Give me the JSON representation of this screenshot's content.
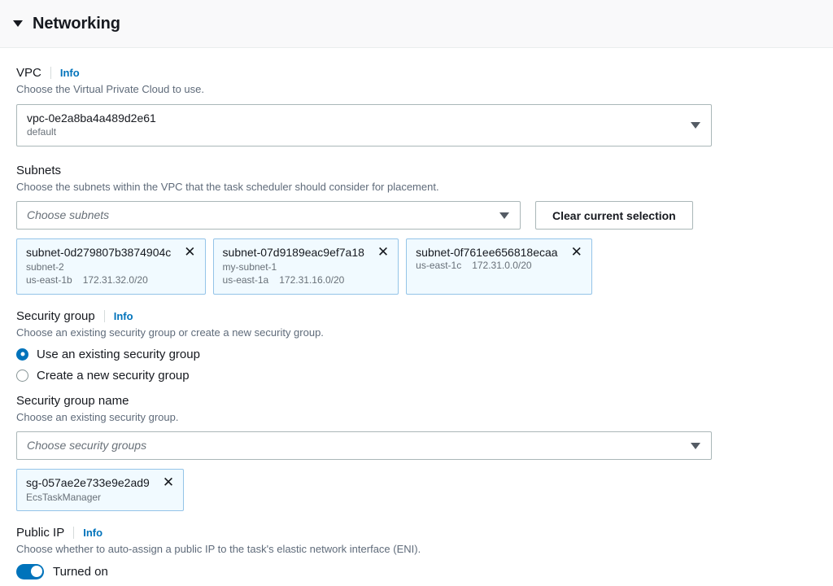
{
  "section": {
    "title": "Networking",
    "collapse_icon": "caret-down-icon"
  },
  "vpc": {
    "label": "VPC",
    "info_label": "Info",
    "description": "Choose the Virtual Private Cloud to use.",
    "selected_value": "vpc-0e2a8ba4a489d2e61",
    "selected_sub": "default"
  },
  "subnets": {
    "label": "Subnets",
    "description": "Choose the subnets within the VPC that the task scheduler should consider for placement.",
    "placeholder": "Choose subnets",
    "clear_button": "Clear current selection",
    "tokens": [
      {
        "id": "subnet-0d279807b3874904c",
        "name": "subnet-2",
        "az": "us-east-1b",
        "cidr": "172.31.32.0/20",
        "remove_icon": "close-icon"
      },
      {
        "id": "subnet-07d9189eac9ef7a18",
        "name": "my-subnet-1",
        "az": "us-east-1a",
        "cidr": "172.31.16.0/20",
        "remove_icon": "close-icon"
      },
      {
        "id": "subnet-0f761ee656818ecaa",
        "name": "",
        "az": "us-east-1c",
        "cidr": "172.31.0.0/20",
        "remove_icon": "close-icon"
      }
    ]
  },
  "security_group": {
    "label": "Security group",
    "info_label": "Info",
    "description": "Choose an existing security group or create a new security group.",
    "options": [
      {
        "label": "Use an existing security group",
        "selected": true
      },
      {
        "label": "Create a new security group",
        "selected": false
      }
    ],
    "name_label": "Security group name",
    "name_description": "Choose an existing security group.",
    "placeholder": "Choose security groups",
    "tokens": [
      {
        "id": "sg-057ae2e733e9e2ad9",
        "name": "EcsTaskManager",
        "remove_icon": "close-icon"
      }
    ]
  },
  "public_ip": {
    "label": "Public IP",
    "info_label": "Info",
    "description": "Choose whether to auto-assign a public IP to the task's elastic network interface (ENI).",
    "toggle_label": "Turned on",
    "toggle_on": true
  },
  "colors": {
    "accent": "#0073bb",
    "link": "#0073bb",
    "header_bg": "#f9f9fa",
    "border": "#aab7b8",
    "token_border": "#94c4e8",
    "token_bg": "#f1faff",
    "text": "#16191f",
    "muted": "#687078"
  }
}
